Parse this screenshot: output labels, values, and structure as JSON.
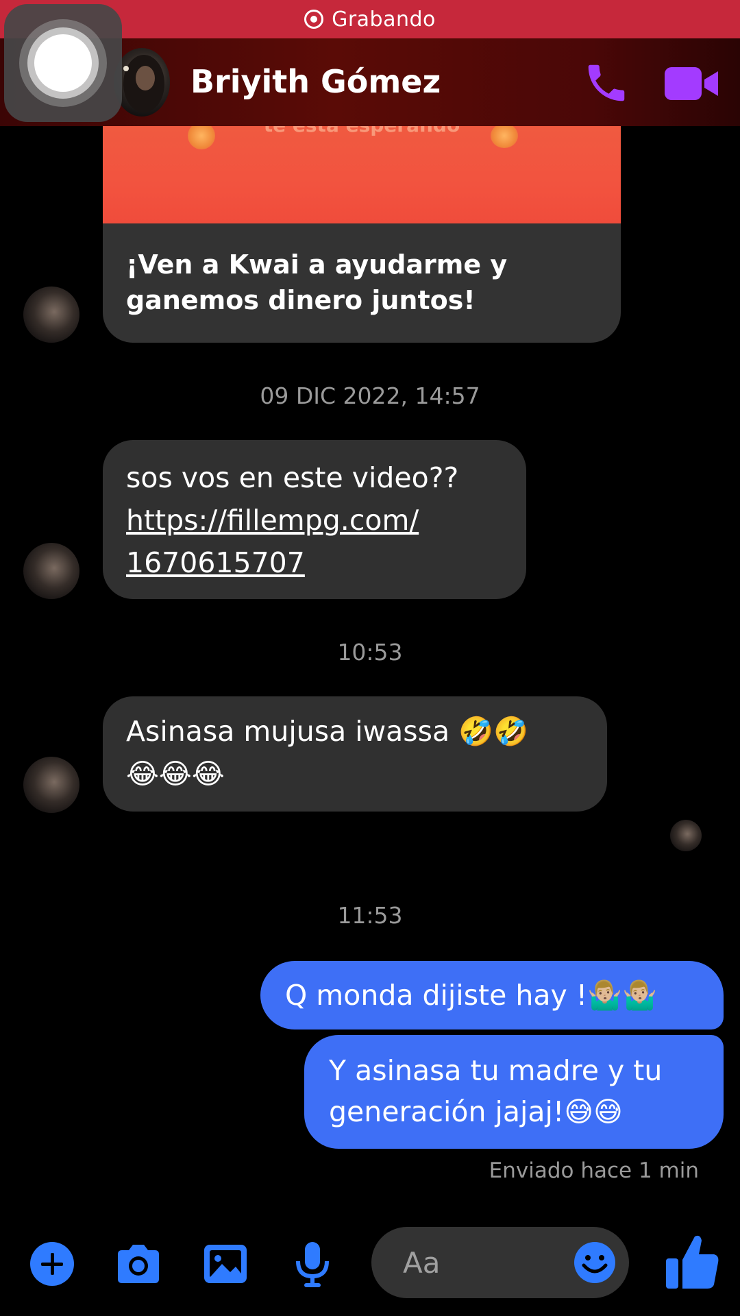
{
  "recording": {
    "label": "Grabando"
  },
  "header": {
    "contact_name": "Briyith Gómez"
  },
  "card": {
    "banner_text": "te está esperando",
    "caption": "¡Ven a Kwai a ayudarme y ganemos dinero juntos!"
  },
  "messages": [
    {
      "timestamp": "09 DIC 2022, 14:57"
    },
    {
      "text": "sos vos en este video??",
      "link_line1": "https://fillempg.com/",
      "link_line2": "1670615707"
    },
    {
      "timestamp": "10:53"
    },
    {
      "text_line1": "Asinasa mujusa iwassa 🤣🤣",
      "text_line2": "😂😂😂"
    },
    {
      "timestamp": "11:53"
    },
    {
      "text": "Q monda dijiste hay !🤷🏼‍♂️🤷🏼‍♂️"
    },
    {
      "text_line1": "Y asinasa tu madre y tu",
      "text_line2": "generación jajaj!😅😅"
    }
  ],
  "status": "Enviado hace 1 min",
  "composer": {
    "placeholder": "Aa"
  },
  "colors": {
    "accent": "#3e6ff6",
    "header_icons": "#a33bff",
    "recording_bar": "#c6283b",
    "incoming_bubble": "#303030",
    "tool_icons": "#2f7bff"
  },
  "icons": [
    "plus-icon",
    "camera-icon",
    "image-icon",
    "microphone-icon",
    "emoji-icon",
    "thumbs-up-icon",
    "phone-icon",
    "video-camera-icon"
  ]
}
